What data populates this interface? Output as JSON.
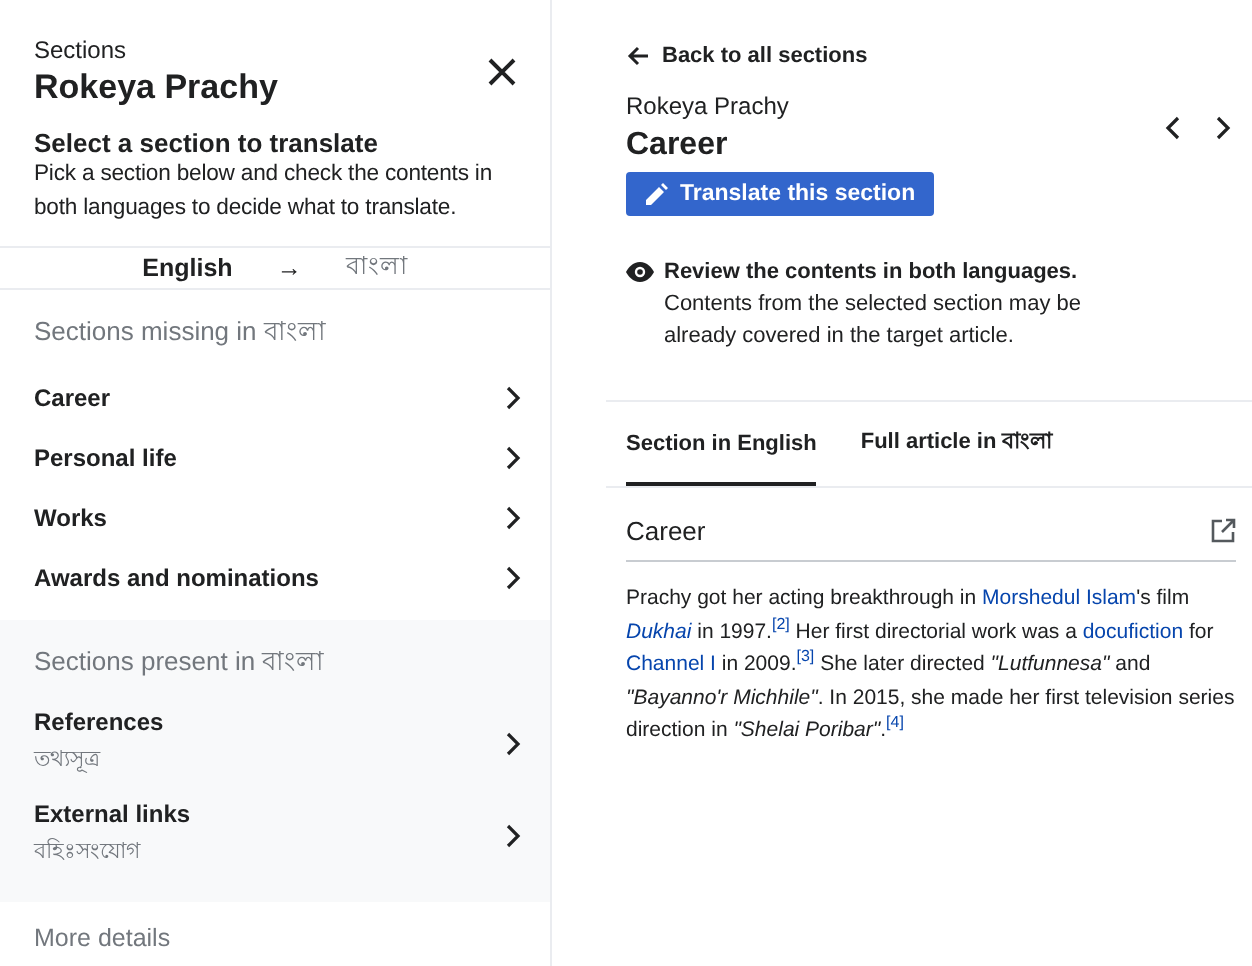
{
  "sidebar": {
    "eyebrow": "Sections",
    "title": "Rokeya Prachy",
    "heading": "Select a section to translate",
    "description": "Pick a section below and check the contents in both languages to decide what to translate.",
    "source_language": "English",
    "arrow": "→",
    "target_language": "বাংলা",
    "groups": [
      {
        "kind": "missing",
        "title": "Sections missing in বাংলা",
        "items": [
          {
            "label": "Career"
          },
          {
            "label": "Personal life"
          },
          {
            "label": "Works"
          },
          {
            "label": "Awards and nominations"
          }
        ]
      },
      {
        "kind": "present",
        "title": "Sections present in বাংলা",
        "items": [
          {
            "label": "References",
            "target": "তথ্যসূত্র"
          },
          {
            "label": "External links",
            "target": "বহিঃসংযোগ"
          }
        ]
      }
    ],
    "more": "More details"
  },
  "detail": {
    "back": "Back to all sections",
    "article": "Rokeya Prachy",
    "section": "Career",
    "translate_button": "Translate this section",
    "notice_title": "Review the contents in both languages.",
    "notice_text": "Contents from the selected section may be already covered in the target article.",
    "tabs": [
      {
        "label": "Section in English",
        "selected": true
      },
      {
        "label": "Full article in বাংলা",
        "selected": false
      }
    ],
    "content_heading": "Career",
    "paragraph": [
      {
        "kind": "text",
        "text": "Prachy got her acting breakthrough in "
      },
      {
        "kind": "link",
        "text": "Morshedul Islam"
      },
      {
        "kind": "text",
        "text": "'s film "
      },
      {
        "kind": "italic_link",
        "text": "Dukhai"
      },
      {
        "kind": "text",
        "text": " in 1997."
      },
      {
        "kind": "ref",
        "text": "[2]"
      },
      {
        "kind": "text",
        "text": " Her first directorial work was a "
      },
      {
        "kind": "link",
        "text": "docufiction"
      },
      {
        "kind": "text",
        "text": " for "
      },
      {
        "kind": "link",
        "text": "Channel I"
      },
      {
        "kind": "text",
        "text": " in 2009."
      },
      {
        "kind": "ref",
        "text": "[3]"
      },
      {
        "kind": "text",
        "text": " She later directed "
      },
      {
        "kind": "italic",
        "text": "\"Lutfunnesa\""
      },
      {
        "kind": "text",
        "text": " and "
      },
      {
        "kind": "italic",
        "text": "\"Bayanno'r Michhile\""
      },
      {
        "kind": "text",
        "text": ". In 2015, she made her first television series direction in "
      },
      {
        "kind": "italic",
        "text": "\"Shelai Poribar\""
      },
      {
        "kind": "text",
        "text": "."
      },
      {
        "kind": "ref",
        "text": "[4]"
      }
    ]
  }
}
